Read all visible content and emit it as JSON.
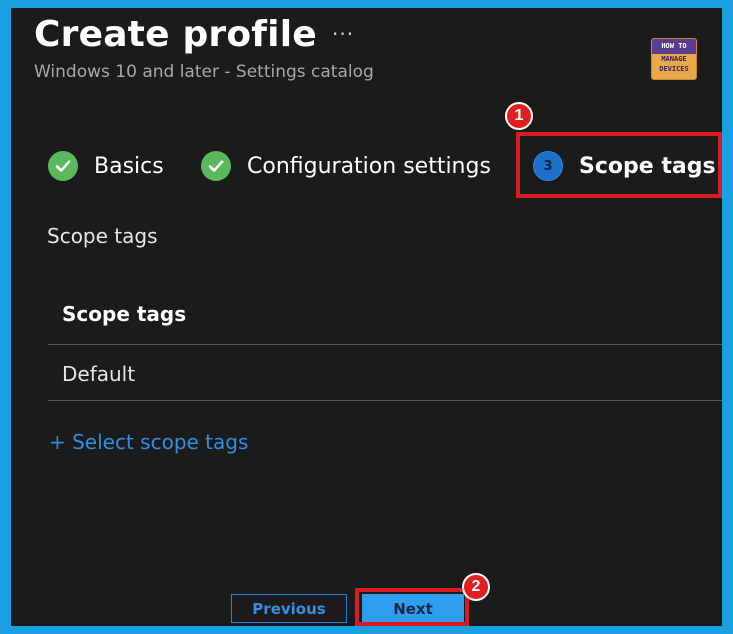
{
  "header": {
    "title": "Create profile",
    "more_label": "···",
    "subtitle": "Windows 10 and later - Settings catalog",
    "logo": {
      "line1": "HOW TO",
      "line2": "MANAGE",
      "line3": "DEVICES"
    }
  },
  "steps": [
    {
      "label": "Basics",
      "state": "completed",
      "icon": "check-icon"
    },
    {
      "label": "Configuration settings",
      "state": "completed",
      "icon": "check-icon"
    },
    {
      "label": "Scope tags",
      "state": "current",
      "number": "3"
    }
  ],
  "annotations": {
    "badge1": "1",
    "badge2": "2",
    "color": "#d81c24"
  },
  "content": {
    "section_label": "Scope tags",
    "table": {
      "header": "Scope tags",
      "rows": [
        "Default"
      ]
    },
    "select_link": "+ Select scope tags"
  },
  "footer": {
    "previous_label": "Previous",
    "next_label": "Next"
  },
  "colors": {
    "accent": "#2f9df0",
    "success": "#5cb85c",
    "background": "#1b1b1b",
    "frame": "#1ba1e2"
  }
}
